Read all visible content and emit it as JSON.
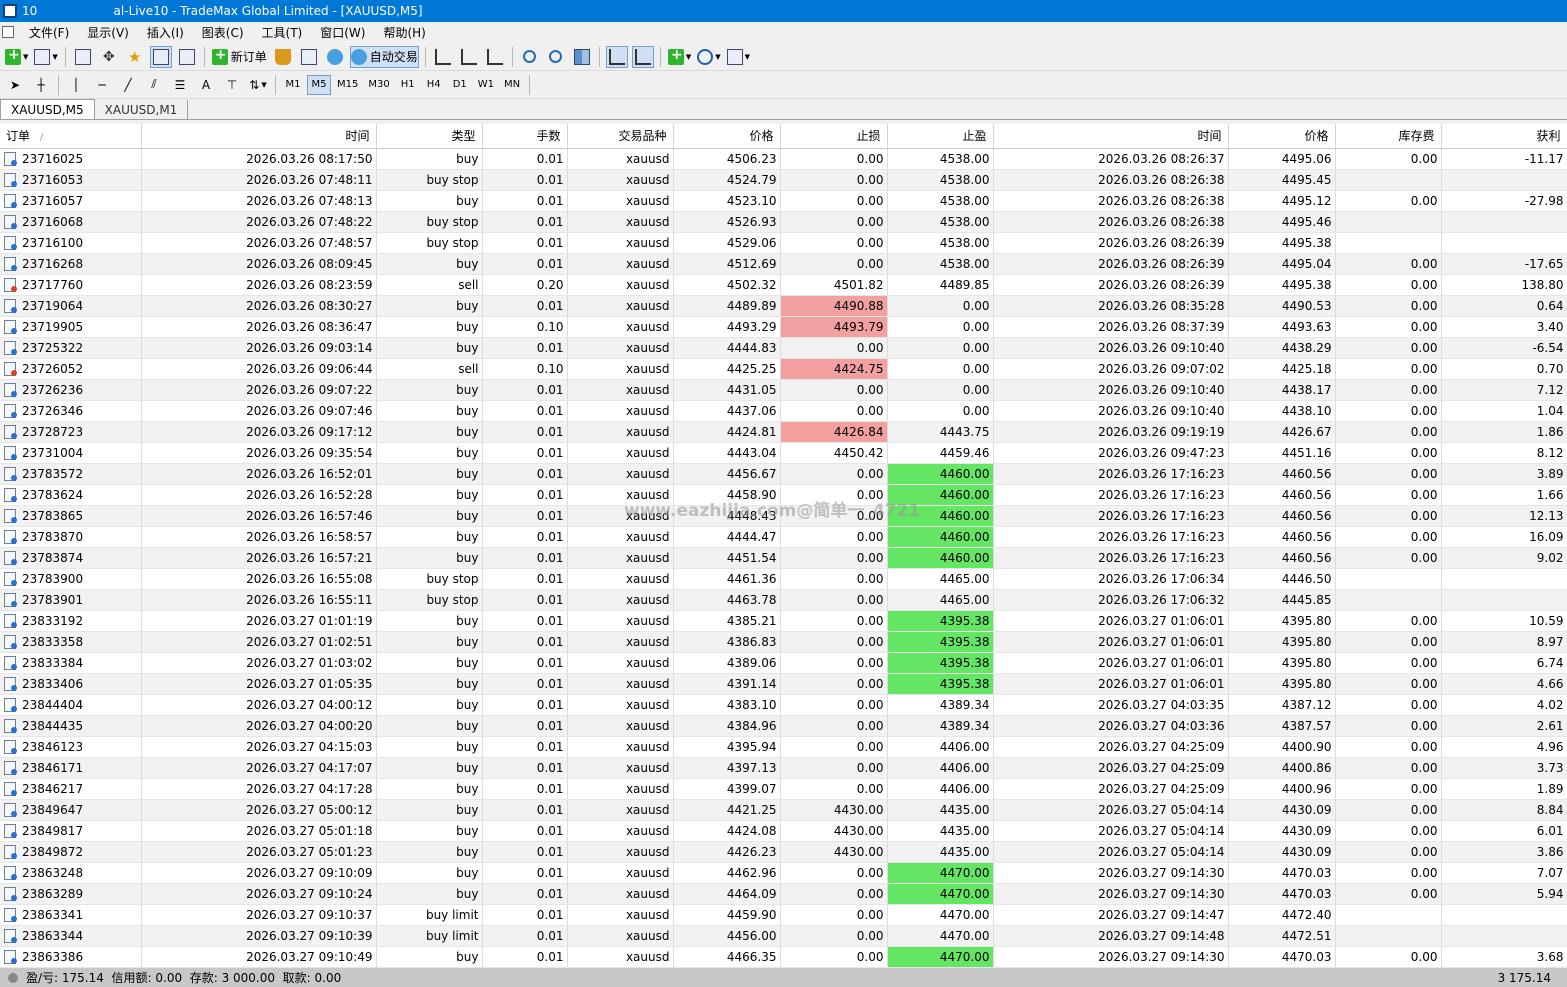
{
  "window": {
    "title": "10                    al-Live10 - TradeMax Global Limited - [XAUUSD,M5]"
  },
  "menu": [
    "文件(F)",
    "显示(V)",
    "插入(I)",
    "图表(C)",
    "工具(T)",
    "窗口(W)",
    "帮助(H)"
  ],
  "toolbar": {
    "new_order_label": "新订单",
    "auto_trade_label": "自动交易",
    "timeframes": [
      "M1",
      "M5",
      "M15",
      "M30",
      "H1",
      "H4",
      "D1",
      "W1",
      "MN"
    ],
    "active_timeframe": "M5",
    "text_tool_label": "A"
  },
  "tabs": [
    "XAUUSD,M5",
    "XAUUSD,M1"
  ],
  "table": {
    "columns": [
      "订单",
      "时间",
      "类型",
      "手数",
      "交易品种",
      "价格",
      "止损",
      "止盈",
      "时间",
      "价格",
      "库存费",
      "获利"
    ],
    "sort_marker": "/",
    "rows": [
      {
        "order": "23716025",
        "open_time": "2026.03.26 08:17:50",
        "type": "buy",
        "lots": "0.01",
        "symbol": "xauusd",
        "price": "4506.23",
        "sl": "0.00",
        "tp": "4538.00",
        "close_time": "2026.03.26 08:26:37",
        "close_price": "4495.06",
        "swap": "0.00",
        "profit": "-11.17",
        "sl_hl": "",
        "tp_hl": ""
      },
      {
        "order": "23716053",
        "open_time": "2026.03.26 07:48:11",
        "type": "buy stop",
        "lots": "0.01",
        "symbol": "xauusd",
        "price": "4524.79",
        "sl": "0.00",
        "tp": "4538.00",
        "close_time": "2026.03.26 08:26:38",
        "close_price": "4495.45",
        "swap": "",
        "profit": "",
        "sl_hl": "",
        "tp_hl": ""
      },
      {
        "order": "23716057",
        "open_time": "2026.03.26 07:48:13",
        "type": "buy",
        "lots": "0.01",
        "symbol": "xauusd",
        "price": "4523.10",
        "sl": "0.00",
        "tp": "4538.00",
        "close_time": "2026.03.26 08:26:38",
        "close_price": "4495.12",
        "swap": "0.00",
        "profit": "-27.98",
        "sl_hl": "",
        "tp_hl": ""
      },
      {
        "order": "23716068",
        "open_time": "2026.03.26 07:48:22",
        "type": "buy stop",
        "lots": "0.01",
        "symbol": "xauusd",
        "price": "4526.93",
        "sl": "0.00",
        "tp": "4538.00",
        "close_time": "2026.03.26 08:26:38",
        "close_price": "4495.46",
        "swap": "",
        "profit": "",
        "sl_hl": "",
        "tp_hl": ""
      },
      {
        "order": "23716100",
        "open_time": "2026.03.26 07:48:57",
        "type": "buy stop",
        "lots": "0.01",
        "symbol": "xauusd",
        "price": "4529.06",
        "sl": "0.00",
        "tp": "4538.00",
        "close_time": "2026.03.26 08:26:39",
        "close_price": "4495.38",
        "swap": "",
        "profit": "",
        "sl_hl": "",
        "tp_hl": ""
      },
      {
        "order": "23716268",
        "open_time": "2026.03.26 08:09:45",
        "type": "buy",
        "lots": "0.01",
        "symbol": "xauusd",
        "price": "4512.69",
        "sl": "0.00",
        "tp": "4538.00",
        "close_time": "2026.03.26 08:26:39",
        "close_price": "4495.04",
        "swap": "0.00",
        "profit": "-17.65",
        "sl_hl": "",
        "tp_hl": ""
      },
      {
        "order": "23717760",
        "open_time": "2026.03.26 08:23:59",
        "type": "sell",
        "lots": "0.20",
        "symbol": "xauusd",
        "price": "4502.32",
        "sl": "4501.82",
        "tp": "4489.85",
        "close_time": "2026.03.26 08:26:39",
        "close_price": "4495.38",
        "swap": "0.00",
        "profit": "138.80",
        "sl_hl": "",
        "tp_hl": ""
      },
      {
        "order": "23719064",
        "open_time": "2026.03.26 08:30:27",
        "type": "buy",
        "lots": "0.01",
        "symbol": "xauusd",
        "price": "4489.89",
        "sl": "4490.88",
        "tp": "0.00",
        "close_time": "2026.03.26 08:35:28",
        "close_price": "4490.53",
        "swap": "0.00",
        "profit": "0.64",
        "sl_hl": "red",
        "tp_hl": ""
      },
      {
        "order": "23719905",
        "open_time": "2026.03.26 08:36:47",
        "type": "buy",
        "lots": "0.10",
        "symbol": "xauusd",
        "price": "4493.29",
        "sl": "4493.79",
        "tp": "0.00",
        "close_time": "2026.03.26 08:37:39",
        "close_price": "4493.63",
        "swap": "0.00",
        "profit": "3.40",
        "sl_hl": "red",
        "tp_hl": ""
      },
      {
        "order": "23725322",
        "open_time": "2026.03.26 09:03:14",
        "type": "buy",
        "lots": "0.01",
        "symbol": "xauusd",
        "price": "4444.83",
        "sl": "0.00",
        "tp": "0.00",
        "close_time": "2026.03.26 09:10:40",
        "close_price": "4438.29",
        "swap": "0.00",
        "profit": "-6.54",
        "sl_hl": "",
        "tp_hl": ""
      },
      {
        "order": "23726052",
        "open_time": "2026.03.26 09:06:44",
        "type": "sell",
        "lots": "0.10",
        "symbol": "xauusd",
        "price": "4425.25",
        "sl": "4424.75",
        "tp": "0.00",
        "close_time": "2026.03.26 09:07:02",
        "close_price": "4425.18",
        "swap": "0.00",
        "profit": "0.70",
        "sl_hl": "red",
        "tp_hl": ""
      },
      {
        "order": "23726236",
        "open_time": "2026.03.26 09:07:22",
        "type": "buy",
        "lots": "0.01",
        "symbol": "xauusd",
        "price": "4431.05",
        "sl": "0.00",
        "tp": "0.00",
        "close_time": "2026.03.26 09:10:40",
        "close_price": "4438.17",
        "swap": "0.00",
        "profit": "7.12",
        "sl_hl": "",
        "tp_hl": ""
      },
      {
        "order": "23726346",
        "open_time": "2026.03.26 09:07:46",
        "type": "buy",
        "lots": "0.01",
        "symbol": "xauusd",
        "price": "4437.06",
        "sl": "0.00",
        "tp": "0.00",
        "close_time": "2026.03.26 09:10:40",
        "close_price": "4438.10",
        "swap": "0.00",
        "profit": "1.04",
        "sl_hl": "",
        "tp_hl": ""
      },
      {
        "order": "23728723",
        "open_time": "2026.03.26 09:17:12",
        "type": "buy",
        "lots": "0.01",
        "symbol": "xauusd",
        "price": "4424.81",
        "sl": "4426.84",
        "tp": "4443.75",
        "close_time": "2026.03.26 09:19:19",
        "close_price": "4426.67",
        "swap": "0.00",
        "profit": "1.86",
        "sl_hl": "red",
        "tp_hl": ""
      },
      {
        "order": "23731004",
        "open_time": "2026.03.26 09:35:54",
        "type": "buy",
        "lots": "0.01",
        "symbol": "xauusd",
        "price": "4443.04",
        "sl": "4450.42",
        "tp": "4459.46",
        "close_time": "2026.03.26 09:47:23",
        "close_price": "4451.16",
        "swap": "0.00",
        "profit": "8.12",
        "sl_hl": "",
        "tp_hl": ""
      },
      {
        "order": "23783572",
        "open_time": "2026.03.26 16:52:01",
        "type": "buy",
        "lots": "0.01",
        "symbol": "xauusd",
        "price": "4456.67",
        "sl": "0.00",
        "tp": "4460.00",
        "close_time": "2026.03.26 17:16:23",
        "close_price": "4460.56",
        "swap": "0.00",
        "profit": "3.89",
        "sl_hl": "",
        "tp_hl": "green"
      },
      {
        "order": "23783624",
        "open_time": "2026.03.26 16:52:28",
        "type": "buy",
        "lots": "0.01",
        "symbol": "xauusd",
        "price": "4458.90",
        "sl": "0.00",
        "tp": "4460.00",
        "close_time": "2026.03.26 17:16:23",
        "close_price": "4460.56",
        "swap": "0.00",
        "profit": "1.66",
        "sl_hl": "",
        "tp_hl": "green"
      },
      {
        "order": "23783865",
        "open_time": "2026.03.26 16:57:46",
        "type": "buy",
        "lots": "0.01",
        "symbol": "xauusd",
        "price": "4448.43",
        "sl": "0.00",
        "tp": "4460.00",
        "close_time": "2026.03.26 17:16:23",
        "close_price": "4460.56",
        "swap": "0.00",
        "profit": "12.13",
        "sl_hl": "",
        "tp_hl": "green"
      },
      {
        "order": "23783870",
        "open_time": "2026.03.26 16:58:57",
        "type": "buy",
        "lots": "0.01",
        "symbol": "xauusd",
        "price": "4444.47",
        "sl": "0.00",
        "tp": "4460.00",
        "close_time": "2026.03.26 17:16:23",
        "close_price": "4460.56",
        "swap": "0.00",
        "profit": "16.09",
        "sl_hl": "",
        "tp_hl": "green"
      },
      {
        "order": "23783874",
        "open_time": "2026.03.26 16:57:21",
        "type": "buy",
        "lots": "0.01",
        "symbol": "xauusd",
        "price": "4451.54",
        "sl": "0.00",
        "tp": "4460.00",
        "close_time": "2026.03.26 17:16:23",
        "close_price": "4460.56",
        "swap": "0.00",
        "profit": "9.02",
        "sl_hl": "",
        "tp_hl": "green"
      },
      {
        "order": "23783900",
        "open_time": "2026.03.26 16:55:08",
        "type": "buy stop",
        "lots": "0.01",
        "symbol": "xauusd",
        "price": "4461.36",
        "sl": "0.00",
        "tp": "4465.00",
        "close_time": "2026.03.26 17:06:34",
        "close_price": "4446.50",
        "swap": "",
        "profit": "",
        "sl_hl": "",
        "tp_hl": ""
      },
      {
        "order": "23783901",
        "open_time": "2026.03.26 16:55:11",
        "type": "buy stop",
        "lots": "0.01",
        "symbol": "xauusd",
        "price": "4463.78",
        "sl": "0.00",
        "tp": "4465.00",
        "close_time": "2026.03.26 17:06:32",
        "close_price": "4445.85",
        "swap": "",
        "profit": "",
        "sl_hl": "",
        "tp_hl": ""
      },
      {
        "order": "23833192",
        "open_time": "2026.03.27 01:01:19",
        "type": "buy",
        "lots": "0.01",
        "symbol": "xauusd",
        "price": "4385.21",
        "sl": "0.00",
        "tp": "4395.38",
        "close_time": "2026.03.27 01:06:01",
        "close_price": "4395.80",
        "swap": "0.00",
        "profit": "10.59",
        "sl_hl": "",
        "tp_hl": "green"
      },
      {
        "order": "23833358",
        "open_time": "2026.03.27 01:02:51",
        "type": "buy",
        "lots": "0.01",
        "symbol": "xauusd",
        "price": "4386.83",
        "sl": "0.00",
        "tp": "4395.38",
        "close_time": "2026.03.27 01:06:01",
        "close_price": "4395.80",
        "swap": "0.00",
        "profit": "8.97",
        "sl_hl": "",
        "tp_hl": "green"
      },
      {
        "order": "23833384",
        "open_time": "2026.03.27 01:03:02",
        "type": "buy",
        "lots": "0.01",
        "symbol": "xauusd",
        "price": "4389.06",
        "sl": "0.00",
        "tp": "4395.38",
        "close_time": "2026.03.27 01:06:01",
        "close_price": "4395.80",
        "swap": "0.00",
        "profit": "6.74",
        "sl_hl": "",
        "tp_hl": "green"
      },
      {
        "order": "23833406",
        "open_time": "2026.03.27 01:05:35",
        "type": "buy",
        "lots": "0.01",
        "symbol": "xauusd",
        "price": "4391.14",
        "sl": "0.00",
        "tp": "4395.38",
        "close_time": "2026.03.27 01:06:01",
        "close_price": "4395.80",
        "swap": "0.00",
        "profit": "4.66",
        "sl_hl": "",
        "tp_hl": "green"
      },
      {
        "order": "23844404",
        "open_time": "2026.03.27 04:00:12",
        "type": "buy",
        "lots": "0.01",
        "symbol": "xauusd",
        "price": "4383.10",
        "sl": "0.00",
        "tp": "4389.34",
        "close_time": "2026.03.27 04:03:35",
        "close_price": "4387.12",
        "swap": "0.00",
        "profit": "4.02",
        "sl_hl": "",
        "tp_hl": ""
      },
      {
        "order": "23844435",
        "open_time": "2026.03.27 04:00:20",
        "type": "buy",
        "lots": "0.01",
        "symbol": "xauusd",
        "price": "4384.96",
        "sl": "0.00",
        "tp": "4389.34",
        "close_time": "2026.03.27 04:03:36",
        "close_price": "4387.57",
        "swap": "0.00",
        "profit": "2.61",
        "sl_hl": "",
        "tp_hl": ""
      },
      {
        "order": "23846123",
        "open_time": "2026.03.27 04:15:03",
        "type": "buy",
        "lots": "0.01",
        "symbol": "xauusd",
        "price": "4395.94",
        "sl": "0.00",
        "tp": "4406.00",
        "close_time": "2026.03.27 04:25:09",
        "close_price": "4400.90",
        "swap": "0.00",
        "profit": "4.96",
        "sl_hl": "",
        "tp_hl": ""
      },
      {
        "order": "23846171",
        "open_time": "2026.03.27 04:17:07",
        "type": "buy",
        "lots": "0.01",
        "symbol": "xauusd",
        "price": "4397.13",
        "sl": "0.00",
        "tp": "4406.00",
        "close_time": "2026.03.27 04:25:09",
        "close_price": "4400.86",
        "swap": "0.00",
        "profit": "3.73",
        "sl_hl": "",
        "tp_hl": ""
      },
      {
        "order": "23846217",
        "open_time": "2026.03.27 04:17:28",
        "type": "buy",
        "lots": "0.01",
        "symbol": "xauusd",
        "price": "4399.07",
        "sl": "0.00",
        "tp": "4406.00",
        "close_time": "2026.03.27 04:25:09",
        "close_price": "4400.96",
        "swap": "0.00",
        "profit": "1.89",
        "sl_hl": "",
        "tp_hl": ""
      },
      {
        "order": "23849647",
        "open_time": "2026.03.27 05:00:12",
        "type": "buy",
        "lots": "0.01",
        "symbol": "xauusd",
        "price": "4421.25",
        "sl": "4430.00",
        "tp": "4435.00",
        "close_time": "2026.03.27 05:04:14",
        "close_price": "4430.09",
        "swap": "0.00",
        "profit": "8.84",
        "sl_hl": "",
        "tp_hl": ""
      },
      {
        "order": "23849817",
        "open_time": "2026.03.27 05:01:18",
        "type": "buy",
        "lots": "0.01",
        "symbol": "xauusd",
        "price": "4424.08",
        "sl": "4430.00",
        "tp": "4435.00",
        "close_time": "2026.03.27 05:04:14",
        "close_price": "4430.09",
        "swap": "0.00",
        "profit": "6.01",
        "sl_hl": "",
        "tp_hl": ""
      },
      {
        "order": "23849872",
        "open_time": "2026.03.27 05:01:23",
        "type": "buy",
        "lots": "0.01",
        "symbol": "xauusd",
        "price": "4426.23",
        "sl": "4430.00",
        "tp": "4435.00",
        "close_time": "2026.03.27 05:04:14",
        "close_price": "4430.09",
        "swap": "0.00",
        "profit": "3.86",
        "sl_hl": "",
        "tp_hl": ""
      },
      {
        "order": "23863248",
        "open_time": "2026.03.27 09:10:09",
        "type": "buy",
        "lots": "0.01",
        "symbol": "xauusd",
        "price": "4462.96",
        "sl": "0.00",
        "tp": "4470.00",
        "close_time": "2026.03.27 09:14:30",
        "close_price": "4470.03",
        "swap": "0.00",
        "profit": "7.07",
        "sl_hl": "",
        "tp_hl": "green"
      },
      {
        "order": "23863289",
        "open_time": "2026.03.27 09:10:24",
        "type": "buy",
        "lots": "0.01",
        "symbol": "xauusd",
        "price": "4464.09",
        "sl": "0.00",
        "tp": "4470.00",
        "close_time": "2026.03.27 09:14:30",
        "close_price": "4470.03",
        "swap": "0.00",
        "profit": "5.94",
        "sl_hl": "",
        "tp_hl": "green"
      },
      {
        "order": "23863341",
        "open_time": "2026.03.27 09:10:37",
        "type": "buy limit",
        "lots": "0.01",
        "symbol": "xauusd",
        "price": "4459.90",
        "sl": "0.00",
        "tp": "4470.00",
        "close_time": "2026.03.27 09:14:47",
        "close_price": "4472.40",
        "swap": "",
        "profit": "",
        "sl_hl": "",
        "tp_hl": ""
      },
      {
        "order": "23863344",
        "open_time": "2026.03.27 09:10:39",
        "type": "buy limit",
        "lots": "0.01",
        "symbol": "xauusd",
        "price": "4456.00",
        "sl": "0.00",
        "tp": "4470.00",
        "close_time": "2026.03.27 09:14:48",
        "close_price": "4472.51",
        "swap": "",
        "profit": "",
        "sl_hl": "",
        "tp_hl": ""
      },
      {
        "order": "23863386",
        "open_time": "2026.03.27 09:10:49",
        "type": "buy",
        "lots": "0.01",
        "symbol": "xauusd",
        "price": "4466.35",
        "sl": "0.00",
        "tp": "4470.00",
        "close_time": "2026.03.27 09:14:30",
        "close_price": "4470.03",
        "swap": "0.00",
        "profit": "3.68",
        "sl_hl": "",
        "tp_hl": "green"
      }
    ]
  },
  "watermark": "www.eazhijia.com@简单一_4721",
  "status": {
    "summary": "盈/亏: 175.14  信用额: 0.00  存款: 3 000.00  取款: 0.00",
    "total_profit": "3 175.14"
  },
  "colors": {
    "titlebar": "#0078d7",
    "sl_highlight": "#f3a0a0",
    "tp_highlight": "#64e664"
  }
}
